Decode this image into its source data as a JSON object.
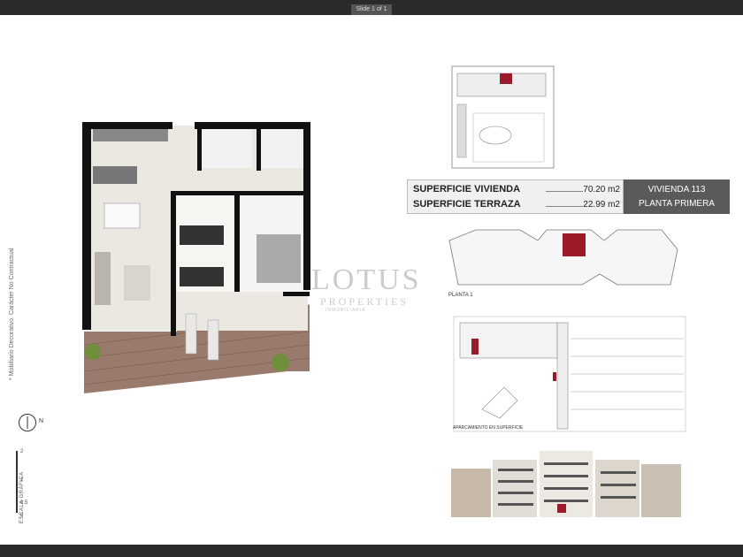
{
  "viewer": {
    "slide_label": "Slide 1 of 1"
  },
  "side_note": "* Mobiliario Decorativo. Carácter No Contractual",
  "scale": {
    "label": "ESCALA GRÁFICA",
    "marks": [
      "0",
      "0.5",
      "1",
      "2"
    ]
  },
  "compass": {
    "north": "N"
  },
  "summary": {
    "rows": [
      {
        "label": "SUPERFICIE VIVIENDA",
        "value": "70.20 m2"
      },
      {
        "label": "SUPERFICIE TERRAZA",
        "value": "22.99 m2"
      }
    ],
    "unit": "VIVIENDA 113",
    "floor": "PLANTA PRIMERA"
  },
  "watermark": {
    "brand": "LOTUS",
    "sub": "PROPERTIES",
    "tag": "INMOBILIARIA"
  },
  "site_plan": {
    "floor_label": "PLANTA 1",
    "parking_label": "APARCAMIENTO EN SUPERFICIE"
  },
  "colors": {
    "highlight": "#9b1b2a",
    "wall": "#111111",
    "terrace": "#8e6b5c"
  }
}
